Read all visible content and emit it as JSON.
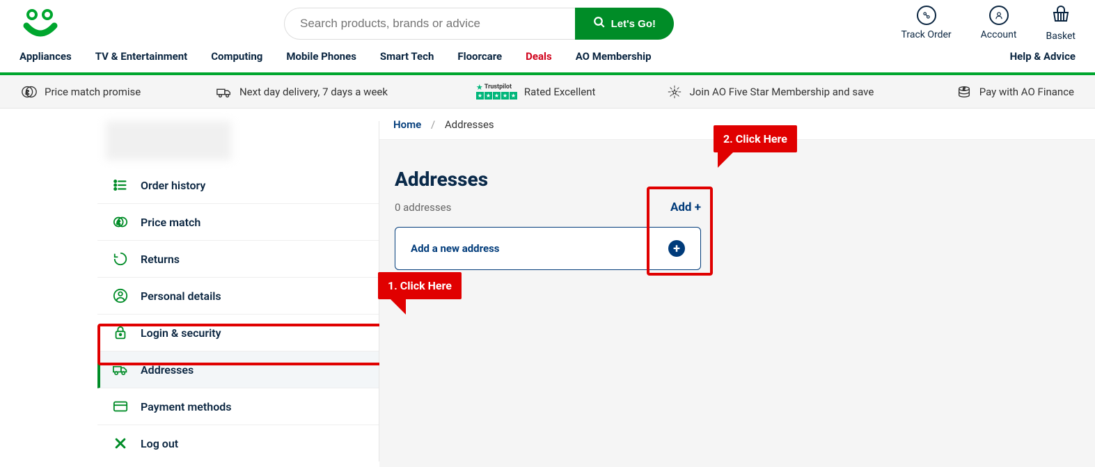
{
  "search": {
    "placeholder": "Search products, brands or advice",
    "button": "Let's Go!"
  },
  "header_actions": {
    "track": "Track Order",
    "account": "Account",
    "basket": "Basket"
  },
  "nav": {
    "appliances": "Appliances",
    "tv": "TV & Entertainment",
    "computing": "Computing",
    "mobile": "Mobile Phones",
    "smart": "Smart Tech",
    "floorcare": "Floorcare",
    "deals": "Deals",
    "membership": "AO Membership",
    "help": "Help & Advice"
  },
  "promo": {
    "price_match": "Price match promise",
    "delivery": "Next day delivery, 7 days a week",
    "trustpilot_label": "Trustpilot",
    "rated": "Rated Excellent",
    "membership": "Join AO Five Star Membership and save",
    "finance": "Pay with AO Finance"
  },
  "sidebar": {
    "items": [
      {
        "label": "Order history"
      },
      {
        "label": "Price match"
      },
      {
        "label": "Returns"
      },
      {
        "label": "Personal details"
      },
      {
        "label": "Login & security"
      },
      {
        "label": "Addresses"
      },
      {
        "label": "Payment methods"
      },
      {
        "label": "Log out"
      }
    ]
  },
  "breadcrumb": {
    "home": "Home",
    "current": "Addresses"
  },
  "panel": {
    "title": "Addresses",
    "count_text": "0 addresses",
    "add_link": "Add +",
    "add_card": "Add a new address"
  },
  "annotations": {
    "step1": "1. Click Here",
    "step2": "2. Click Here"
  }
}
